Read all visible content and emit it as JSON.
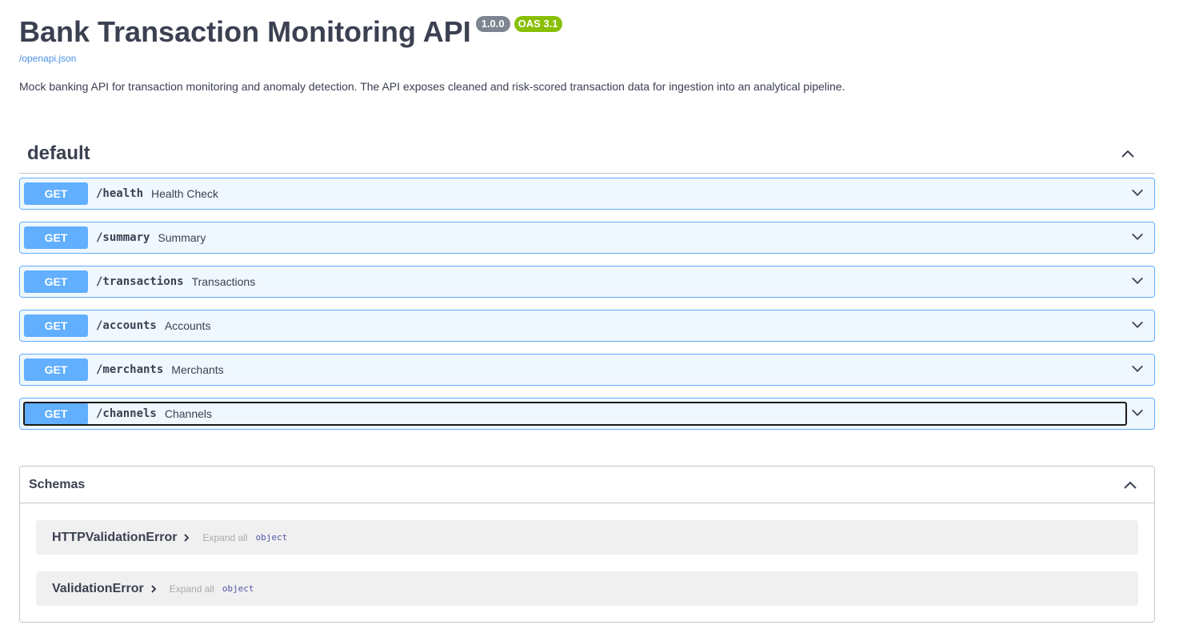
{
  "info": {
    "title": "Bank Transaction Monitoring API",
    "version": "1.0.0",
    "oas_version": "OAS 3.1",
    "spec_link": "/openapi.json",
    "description": "Mock banking API for transaction monitoring and anomaly detection. The API exposes cleaned and risk-scored transaction data for ingestion into an analytical pipeline."
  },
  "tag": {
    "name": "default",
    "operations": [
      {
        "method": "GET",
        "path": "/health",
        "summary": "Health Check"
      },
      {
        "method": "GET",
        "path": "/summary",
        "summary": "Summary"
      },
      {
        "method": "GET",
        "path": "/transactions",
        "summary": "Transactions"
      },
      {
        "method": "GET",
        "path": "/accounts",
        "summary": "Accounts"
      },
      {
        "method": "GET",
        "path": "/merchants",
        "summary": "Merchants"
      },
      {
        "method": "GET",
        "path": "/channels",
        "summary": "Channels"
      }
    ]
  },
  "schemas": {
    "title": "Schemas",
    "models": [
      {
        "name": "HTTPValidationError",
        "expand_all": "Expand all",
        "type": "object"
      },
      {
        "name": "ValidationError",
        "expand_all": "Expand all",
        "type": "object"
      }
    ]
  },
  "colors": {
    "get_method": "#61affe",
    "oas_badge": "#89bf04",
    "version_badge": "#7d8492",
    "link": "#4990e2"
  },
  "icons": {
    "collapse": "chevron-up-icon",
    "expand": "chevron-down-icon",
    "model_expand": "chevron-right-icon"
  }
}
